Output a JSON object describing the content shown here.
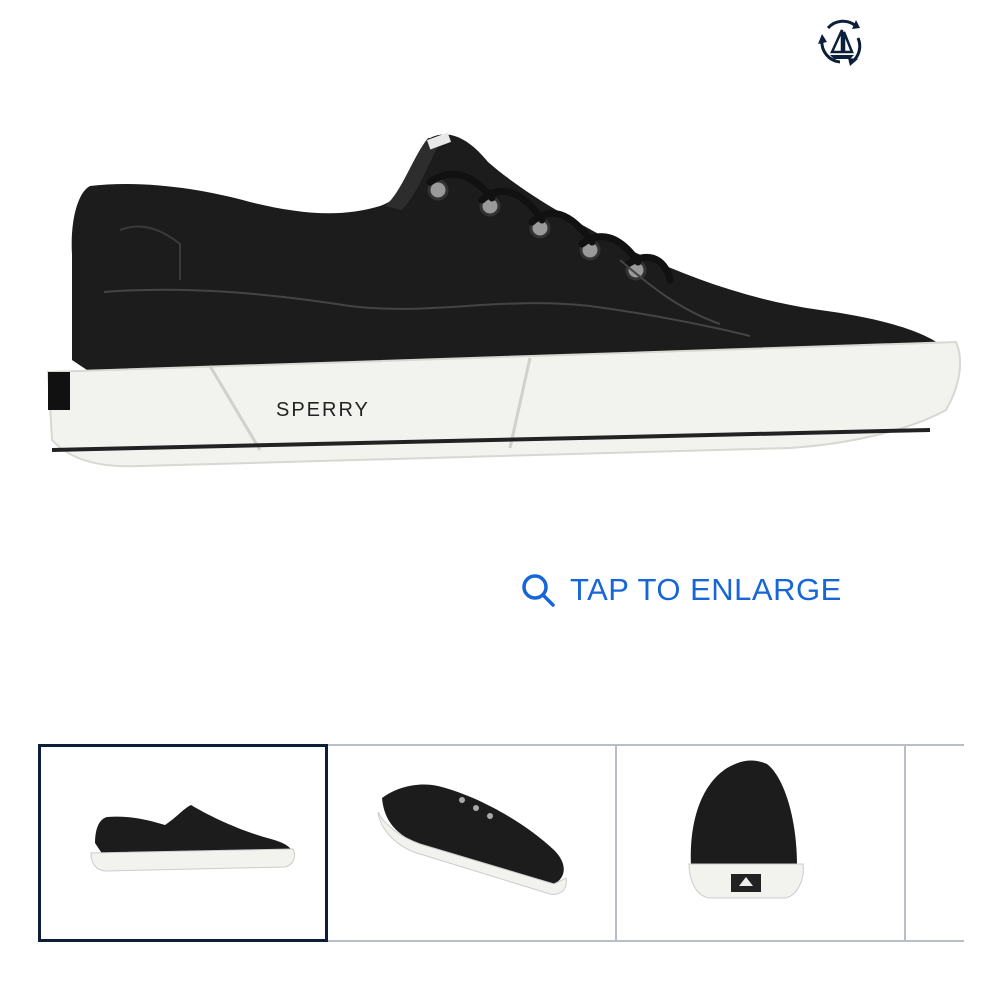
{
  "badge": {
    "icon": "sustainable-sailboat-icon",
    "color": "#0c1f3a"
  },
  "product_image": {
    "brand_text": "SPERRY",
    "shoe_color": "#1c1c1c",
    "sole_color": "#f2f2ee"
  },
  "enlarge": {
    "label": "TAP TO ENLARGE",
    "icon": "magnifier-icon",
    "color": "#1666d8"
  },
  "thumbnails": [
    {
      "view": "side",
      "selected": true
    },
    {
      "view": "angled",
      "selected": false
    },
    {
      "view": "back",
      "selected": false
    },
    {
      "view": "partial",
      "selected": false
    }
  ],
  "colors": {
    "selected_border": "#0c1f3a",
    "thumb_border": "#b9bec6"
  }
}
